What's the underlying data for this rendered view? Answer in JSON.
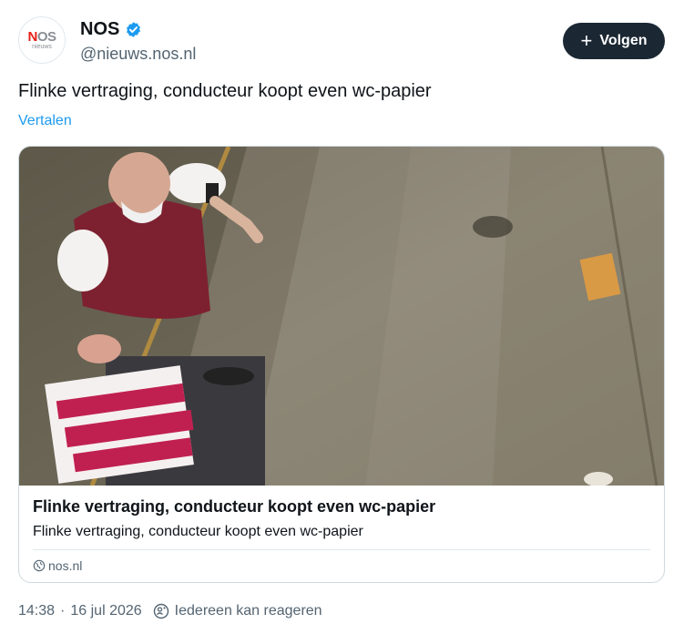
{
  "author": {
    "logo_main_n": "N",
    "logo_main_os": "OS",
    "logo_sub": "nieuws",
    "name": "NOS",
    "handle": "@nieuws.nos.nl",
    "verified_icon": "verified-badge-icon"
  },
  "follow_button": {
    "label": "Volgen",
    "icon": "plus-icon"
  },
  "tweet": {
    "text": "Flinke vertraging, conducteur koopt even wc-papier",
    "translate_label": "Vertalen"
  },
  "card": {
    "title": "Flinke vertraging, conducteur koopt even wc-papier",
    "description": "Flinke vertraging, conducteur koopt even wc-papier",
    "source": "nos.nl",
    "source_icon": "globe-icon"
  },
  "meta": {
    "time": "14:38",
    "separator": "·",
    "date": "16 jul 2026",
    "reply_setting": "Iedereen kan reageren",
    "reply_icon": "reply-settings-icon"
  },
  "colors": {
    "accent": "#1d9bf0",
    "follow_bg": "#1b2733",
    "muted_text": "#536471",
    "nos_red": "#e61e14"
  }
}
